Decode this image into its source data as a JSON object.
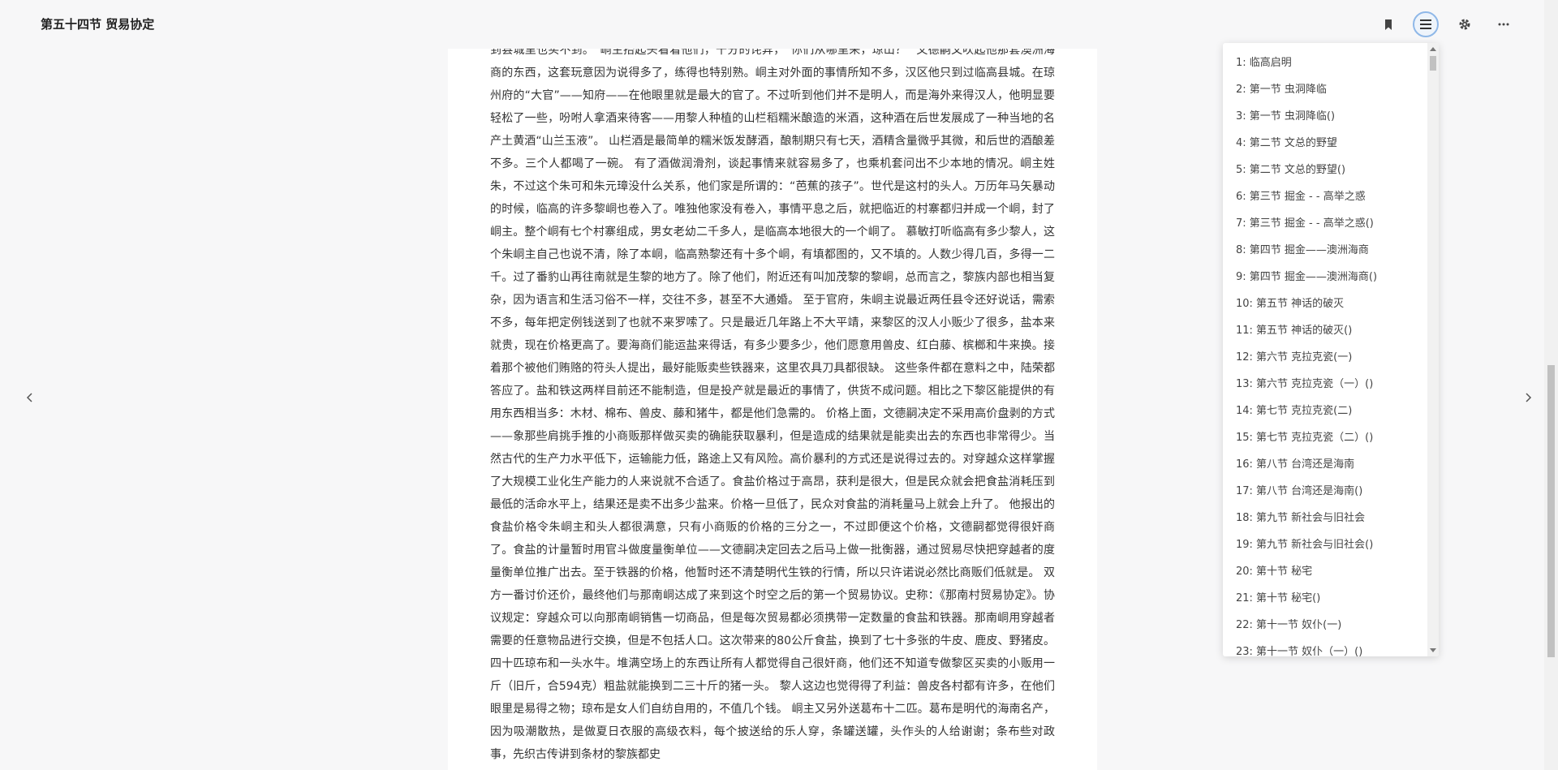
{
  "header": {
    "title": "第五十四节 贸易协定"
  },
  "toolbar": {
    "bookmark_icon": "bookmark-icon",
    "toc_icon": "list-icon",
    "settings_icon": "gear-icon",
    "more_icon": "more-horizontal-icon"
  },
  "content": {
    "paragraphs": [
      "到县城里也买不到。“峒主抬起头看着他们，十分的诧异，“你们从哪里来，琼山？” 文德嗣又吹起他那套澳洲海商的东西，这套玩意因为说得多了，练得也特别熟。峒主对外面的事情所知不多，汉区他只到过临高县城。在琼州府的“大官”——知府——在他眼里就是最大的官了。不过听到他们并不是明人，而是海外来得汉人，他明显要轻松了一些，吩咐人拿酒来待客——用黎人种植的山栏稻糯米酿造的米酒，这种酒在后世发展成了一种当地的名产土黄酒“山兰玉液”。 山栏酒是最简单的糯米饭发酵酒，酿制期只有七天，酒精含量微乎其微，和后世的酒酿差不多。三个人都喝了一碗。 有了酒做润滑剂，谈起事情来就容易多了，也乘机套问出不少本地的情况。峒主姓朱，不过这个朱可和朱元璋没什么关系，他们家是所谓的：“芭蕉的孩子”。世代是这村的头人。万历年马矢暴动的时候，临高的许多黎峒也卷入了。唯独他家没有卷入，事情平息之后，就把临近的村寨都归并成一个峒，封了峒主。整个峒有七个村寨组成，男女老幼二千多人，是临高本地很大的一个峒了。 慕敏打听临高有多少黎人，这个朱峒主自己也说不清，除了本峒，临高熟黎还有十多个峒，有填都图的，又不填的。人数少得几百，多得一二千。过了番豹山再往南就是生黎的地方了。除了他们，附近还有叫加茂黎的黎峒，总而言之，黎族内部也相当复杂，因为语言和生活习俗不一样，交往不多，甚至不大通婚。 至于官府，朱峒主说最近两任县令还好说话，需索不多，每年把定例钱送到了也就不来罗嗦了。只是最近几年路上不大平靖，来黎区的汉人小贩少了很多，盐本来就贵，现在价格更高了。要海商们能运盐来得话，有多少要多少，他们愿意用兽皮、红白藤、槟榔和牛来换。接着那个被他们贿赂的符头人提出，最好能贩卖些铁器来，这里农具刀具都很缺。 这些条件都在意料之中，陆荣都答应了。盐和铁这两样目前还不能制造，但是投产就是最近的事情了，供货不成问题。相比之下黎区能提供的有用东西相当多：木材、棉布、兽皮、藤和猪牛，都是他们急需的。 价格上面，文德嗣决定不采用高价盘剥的方式——象那些肩挑手推的小商贩那样做买卖的确能获取暴利，但是造成的结果就是能卖出去的东西也非常得少。当然古代的生产力水平低下，运输能力低，路途上又有风险。高价暴利的方式还是说得过去的。对穿越众这样掌握了大规模工业化生产能力的人来说就不合适了。食盐价格过于高昂，获利是很大，但是民众就会把食盐消耗压到最低的活命水平上，结果还是卖不出多少盐来。价格一旦低了，民众对食盐的消耗量马上就会上升了。 他报出的食盐价格令朱峒主和头人都很满意，只有小商贩的价格的三分之一，不过即便这个价格，文德嗣都觉得很奸商了。食盐的计量暂时用官斗做度量衡单位——文德嗣决定回去之后马上做一批衡器，通过贸易尽快把穿越者的度量衡单位推广出去。至于铁器的价格，他暂时还不清楚明代生铁的行情，所以只许诺说必然比商贩们低就是。 双方一番讨价还价，最终他们与那南峒达成了来到这个时空之后的第一个贸易协议。史称：《那南村贸易协定》。协议规定：穿越众可以向那南峒销售一切商品，但是每次贸易都必须携带一定数量的食盐和铁器。那南峒用穿越者需要的任意物品进行交换，但是不包括人口。这次带来的80公斤食盐，换到了七十多张的牛皮、鹿皮、野猪皮。四十匹琼布和一头水牛。堆满空场上的东西让所有人都觉得自己很奸商，他们还不知道专做黎区买卖的小贩用一斤（旧斤，合594克）粗盐就能换到二三十斤的猪一头。 黎人这边也觉得得了利益：兽皮各村都有许多，在他们眼里是易得之物；琼布是女人们自纺自用的，不值几个钱。 峒主又另外送葛布十二匹。葛布是明代的海南名产，因为吸潮散热，是做夏日衣服的高级衣料，每个披送给的乐人穿，条罐送罐，头作头的人给谢谢；条布些对政事，先织古传讲到条材的黎族都史"
    ]
  },
  "nav": {
    "prev_icon": "chevron-left-icon",
    "next_icon": "chevron-right-icon"
  },
  "toc": {
    "items": [
      "1: 临高启明",
      "2:  第一节 虫洞降临",
      "3: 第一节 虫洞降临()",
      "4: 第二节 文总的野望",
      "5: 第二节 文总的野望()",
      "6: 第三节 掘金 -  - 高举之惑",
      "7: 第三节 掘金 -  - 高举之惑()",
      "8: 第四节 掘金——澳洲海商",
      "9: 第四节 掘金——澳洲海商()",
      "10: 第五节 神话的破灭",
      "11: 第五节 神话的破灭()",
      "12: 第六节 克拉克瓷(一)",
      "13: 第六节 克拉克瓷（一）()",
      "14: 第七节 克拉克瓷(二)",
      "15: 第七节 克拉克瓷（二）()",
      "16: 第八节 台湾还是海南",
      "17: 第八节 台湾还是海南()",
      "18: 第九节 新社会与旧社会",
      "19: 第九节 新社会与旧社会()",
      "20: 第十节 秘宅",
      "21: 第十节 秘宅()",
      "22: 第十一节 奴仆(一)",
      "23: 第十一节 奴仆（一）()"
    ]
  }
}
